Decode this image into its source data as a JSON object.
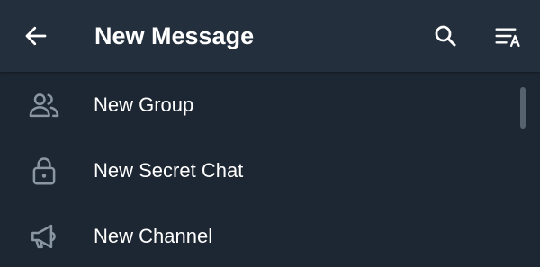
{
  "header": {
    "title": "New Message",
    "back_icon": "arrow-left-icon",
    "search_icon": "search-icon",
    "sort_icon": "sort-alphabetical-icon"
  },
  "menu": {
    "items": [
      {
        "label": "New Group",
        "icon": "group-icon"
      },
      {
        "label": "New Secret Chat",
        "icon": "lock-icon"
      },
      {
        "label": "New Channel",
        "icon": "megaphone-icon"
      }
    ]
  },
  "colors": {
    "background": "#1d2733",
    "header": "#232f3d",
    "text": "#ffffff",
    "icon_muted": "#8a96a3"
  }
}
